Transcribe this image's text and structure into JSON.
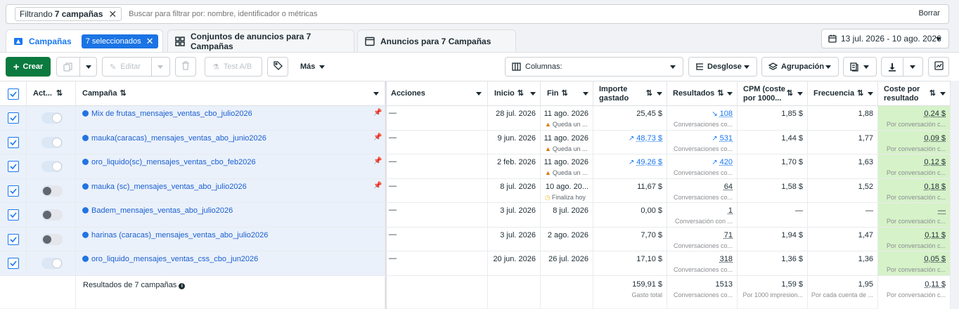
{
  "filter": {
    "chip_prefix": "Filtrando",
    "chip_bold": "7 campañas",
    "search_placeholder": "Buscar para filtrar por: nombre, identificador o métricas",
    "clear_label": "Borrar"
  },
  "tabs": [
    {
      "label": "Campañas",
      "badge": "7 seleccionados"
    },
    {
      "label": "Conjuntos de anuncios para 7 Campañas"
    },
    {
      "label": "Anuncios para 7 Campañas"
    }
  ],
  "date_range": "13 jul. 2026 - 10 ago. 2026",
  "toolbar": {
    "create": "Crear",
    "edit": "Editar",
    "ab_test": "Test A/B",
    "more": "Más",
    "columns": "Columnas:",
    "breakdown": "Desglose",
    "grouping": "Agrupación"
  },
  "columns": {
    "activation": "Act...",
    "campaign": "Campaña",
    "actions": "Acciones",
    "start": "Inicio",
    "end": "Fin",
    "spent_1": "Importe",
    "spent_2": "gastado",
    "results": "Resultados",
    "cpm_1": "CPM (coste",
    "cpm_2": "por 1000...",
    "frequency": "Frecuencia",
    "cpr_1": "Coste por",
    "cpr_2": "resultado"
  },
  "rows": [
    {
      "name": "Mix de frutas_mensajes_ventas_cbo_julio2026",
      "toggle": "on",
      "pinned": true,
      "actions": "—",
      "start": "28 jul. 2026",
      "end": "11 ago. 2026",
      "end_note": "Queda un ...",
      "end_warn": true,
      "spent": "25,45 $",
      "spent_trend": "",
      "results": "108",
      "results_trend": "down",
      "results_sub": "Conversaciones co...",
      "cpm": "1,85 $",
      "freq": "1,88",
      "cpr": "0,24 $",
      "cpr_sub": "Por conversación c..."
    },
    {
      "name": "mauka(caracas)_mensajes_ventas_abo_junio2026",
      "toggle": "on",
      "pinned": true,
      "actions": "—",
      "start": "9 jun. 2026",
      "end": "11 ago. 2026",
      "end_note": "Queda un ...",
      "end_warn": true,
      "spent": "48,73 $",
      "spent_trend": "up",
      "results": "531",
      "results_trend": "up",
      "results_sub": "Conversaciones co...",
      "cpm": "1,44 $",
      "freq": "1,77",
      "cpr": "0,09 $",
      "cpr_sub": "Por conversación c..."
    },
    {
      "name": "oro_liquido(sc)_mensajes_ventas_cbo_feb2026",
      "toggle": "on",
      "pinned": true,
      "actions": "—",
      "start": "2 feb. 2026",
      "end": "11 ago. 2026",
      "end_note": "Queda un ...",
      "end_warn": true,
      "spent": "49,26 $",
      "spent_trend": "up",
      "results": "420",
      "results_trend": "up",
      "results_sub": "Conversaciones co...",
      "cpm": "1,70 $",
      "freq": "1,63",
      "cpr": "0,12 $",
      "cpr_sub": "Por conversación c..."
    },
    {
      "name": "mauka (sc)_mensajes_ventas_abo_julio2026",
      "toggle": "off",
      "pinned": true,
      "actions": "—",
      "start": "8 jul. 2026",
      "end": "10 ago. 20...",
      "end_note": "Finaliza hoy",
      "end_warn": false,
      "spent": "11,67 $",
      "spent_trend": "",
      "results": "64",
      "results_trend": "",
      "results_sub": "Conversaciones co...",
      "cpm": "1,58 $",
      "freq": "1,52",
      "cpr": "0,18 $",
      "cpr_sub": "Por conversación c..."
    },
    {
      "name": "Badem_mensajes_ventas_abo_julio2026",
      "toggle": "off",
      "pinned": false,
      "actions": "—",
      "start": "3 jul. 2026",
      "end": "8 jul. 2026",
      "end_note": "",
      "end_warn": false,
      "spent": "0,00 $",
      "spent_trend": "",
      "results": "1",
      "results_trend": "",
      "results_sub": "Conversación con ...",
      "cpm": "—",
      "freq": "—",
      "cpr": "—",
      "cpr_sub": "Por conversación c..."
    },
    {
      "name": "harinas (caracas)_mensajes_ventas_abo_julio2026",
      "toggle": "off",
      "pinned": false,
      "actions": "—",
      "start": "3 jul. 2026",
      "end": "2 ago. 2026",
      "end_note": "",
      "end_warn": false,
      "spent": "7,70 $",
      "spent_trend": "",
      "results": "71",
      "results_trend": "",
      "results_sub": "Conversaciones co...",
      "cpm": "1,94 $",
      "freq": "1,47",
      "cpr": "0,11 $",
      "cpr_sub": "Por conversación c..."
    },
    {
      "name": "oro_liquido_mensajes_ventas_css_cbo_jun2026",
      "toggle": "on",
      "pinned": false,
      "actions": "—",
      "start": "20 jun. 2026",
      "end": "26 jul. 2026",
      "end_note": "",
      "end_warn": false,
      "spent": "17,10 $",
      "spent_trend": "",
      "results": "318",
      "results_trend": "",
      "results_sub": "Conversaciones co...",
      "cpm": "1,36 $",
      "freq": "1,36",
      "cpr": "0,05 $",
      "cpr_sub": "Por conversación c..."
    }
  ],
  "totals": {
    "label": "Resultados de 7 campañas",
    "spent": "159,91 $",
    "spent_sub": "Gasto total",
    "results": "1513",
    "results_sub": "Conversaciones co...",
    "cpm": "1,59 $",
    "cpm_sub": "Por 1000 impresion...",
    "freq": "1,95",
    "freq_sub": "Por cada cuenta de ...",
    "cpr": "0,11 $",
    "cpr_sub": "Por conversación c..."
  }
}
